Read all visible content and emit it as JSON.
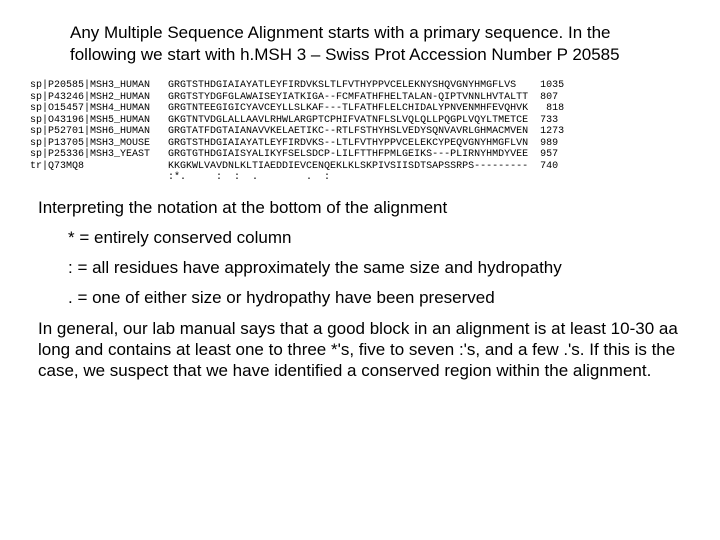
{
  "intro": "Any Multiple Sequence Alignment starts with a primary sequence. In the following we start with h.MSH 3 – Swiss Prot Accession Number P 20585",
  "alignment": {
    "rows": [
      {
        "id": "sp|P20585|MSH3_HUMAN",
        "seq": "GRGTSTHDGIAIAYATLEYFIRDVKSLTLFVTHYPPVCELEKNYSHQVGNYHMGFLVS",
        "num": "1035"
      },
      {
        "id": "sp|P43246|MSH2_HUMAN",
        "seq": "GRGTSTYDGFGLAWAISEYIATKIGA--FCMFATHFHELTALAN-QIPTVNNLHVTALTT",
        "num": "807"
      },
      {
        "id": "sp|O15457|MSH4_HUMAN",
        "seq": "GRGTNTEEGIGICYAVCEYLLSLKAF---TLFATHFLELCHIDALYPNVENMHFEVQHVK",
        "num": " 818"
      },
      {
        "id": "sp|O43196|MSH5_HUMAN",
        "seq": "GKGTNTVDGLALLAAVLRHWLARGPTCPHIFVATNFLSLVQLQLLPQGPLVQYLTMETCE",
        "num": "733"
      },
      {
        "id": "sp|P52701|MSH6_HUMAN",
        "seq": "GRGTATFDGTAIANAVVKELAETIKC--RTLFSTHYHSLVEDYSQNVAVRLGHMACMVEN",
        "num": "1273"
      },
      {
        "id": "sp|P13705|MSH3_MOUSE",
        "seq": "GRGTSTHDGIAIAYATLEYFIRDVKS--LTLFVTHYPPVCELEKCYPEQVGNYHMGFLVN",
        "num": "989"
      },
      {
        "id": "sp|P25336|MSH3_YEAST",
        "seq": "GRGTGTHDGIAISYALIKYFSELSDCP-LILFTTHFPMLGEIKS---PLIRNYHMDYVEE",
        "num": "957"
      },
      {
        "id": "tr|Q73MQ8            ",
        "seq": "KKGKWLVAVDNLKLTIAEDDIEVCENQEKLKLSKPIVSIISDTSAPSSRPS---------",
        "num": "740"
      }
    ],
    "conservation": "                       :*.     :  :  .        .  :"
  },
  "interpHeading": "Interpreting the notation at the bottom of the alignment",
  "legend": {
    "star": "* = entirely conserved column",
    "colon": ": = all residues have approximately the same size and hydropathy",
    "dot": ". = one of either size or hydropathy have been preserved"
  },
  "general": "In general, our lab manual says that a good block in an alignment is at least 10-30 aa long and contains at least one to three *'s, five to seven :'s, and a few .'s.  If this is the case, we suspect that we have identified a conserved region within the alignment."
}
